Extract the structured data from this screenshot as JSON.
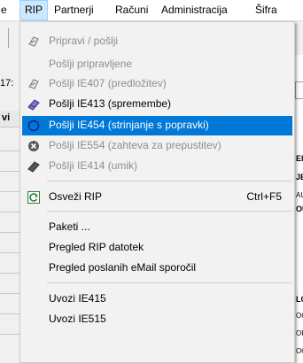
{
  "menubar": {
    "items": [
      {
        "label": "e"
      },
      {
        "label": "RIP"
      },
      {
        "label": "Partnerji"
      },
      {
        "label": "Računi"
      },
      {
        "label": "Administracija"
      },
      {
        "label": "Šifra"
      }
    ]
  },
  "background": {
    "left_label": "17:",
    "column_header": "vi",
    "right_fragments": [
      "El",
      "JE",
      "AUT",
      "OU",
      "LO",
      "OC",
      "OR",
      "OC"
    ]
  },
  "dropdown": {
    "items": [
      {
        "label": "Pripravi / pošlji",
        "enabled": false,
        "icon": "paper-plane-icon"
      },
      {
        "label": "Pošlji pripravljene",
        "enabled": false,
        "icon": ""
      },
      {
        "label": "Pošlji IE407 (predložitev)",
        "enabled": false,
        "icon": "paper-plane-icon"
      },
      {
        "label": "Pošlji IE413 (spremembe)",
        "enabled": true,
        "icon": "eraser-icon"
      },
      {
        "label": "Pošlji IE454 (strinjanje s popravki)",
        "enabled": true,
        "highlighted": true,
        "icon": "circle-icon"
      },
      {
        "label": "Pošlji IE554 (zahteva za prepustitev)",
        "enabled": false,
        "icon": "cancel-icon"
      },
      {
        "label": "Pošlji IE414 (umik)",
        "enabled": false,
        "icon": "eraser-icon"
      },
      {
        "label": "Osveži RIP",
        "enabled": true,
        "shortcut": "Ctrl+F5",
        "icon": "refresh-icon"
      },
      {
        "label": "Paketi ...",
        "enabled": true,
        "icon": ""
      },
      {
        "label": "Pregled RIP datotek",
        "enabled": true,
        "icon": ""
      },
      {
        "label": "Pregled poslanih eMail sporočil",
        "enabled": true,
        "icon": ""
      },
      {
        "label": "Uvozi IE415",
        "enabled": true,
        "icon": ""
      },
      {
        "label": "Uvozi IE515",
        "enabled": true,
        "icon": ""
      }
    ]
  },
  "colors": {
    "highlight": "#0078d7",
    "disabled_text": "#8d8d8d",
    "menu_bg": "#f2f2f2",
    "active_menubar": "#cce8ff"
  }
}
